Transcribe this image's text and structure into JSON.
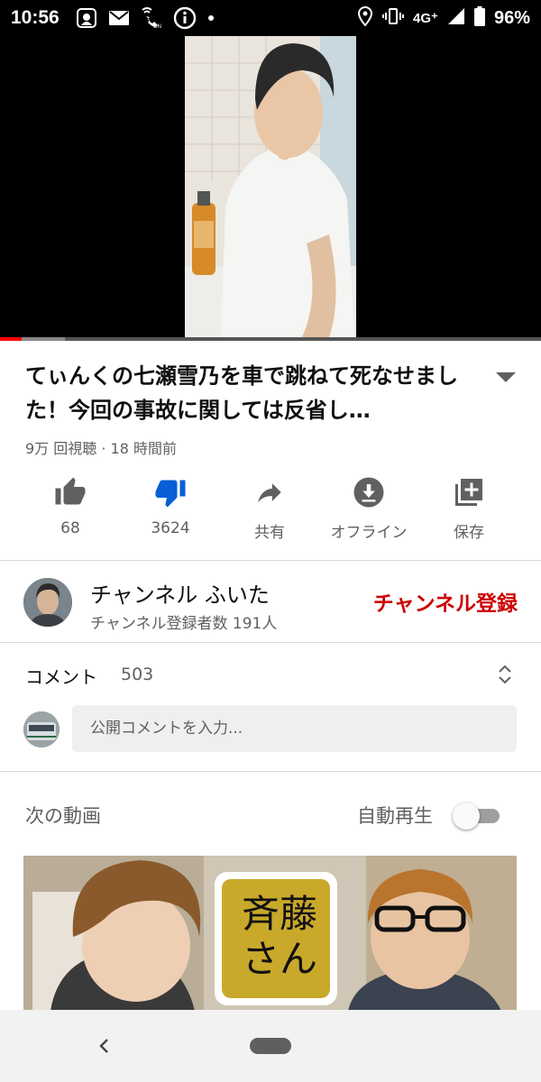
{
  "status_bar": {
    "time": "10:56",
    "network": "4G⁺",
    "battery": "96%",
    "icons": [
      "app-notification-icon",
      "mail-icon",
      "wifi-calling-icon",
      "info-icon",
      "dot-icon",
      "location-icon",
      "vibrate-icon",
      "signal-icon",
      "battery-icon"
    ]
  },
  "video": {
    "progress_played": 0.04,
    "progress_buffered": 0.12
  },
  "title": "てぃんくの七瀬雪乃を車で跳ねて死なせました！今回の事故に関しては反省し…",
  "meta": "9万 回視聴 · 18 時間前",
  "actions": [
    {
      "icon": "thumbs-up-icon",
      "label": "68"
    },
    {
      "icon": "thumbs-down-icon",
      "label": "3624"
    },
    {
      "icon": "share-icon",
      "label": "共有"
    },
    {
      "icon": "download-icon",
      "label": "オフライン"
    },
    {
      "icon": "save-playlist-icon",
      "label": "保存"
    }
  ],
  "channel": {
    "name": "チャンネル ふいた",
    "subscribers": "チャンネル登録者数 191人",
    "subscribe_label": "チャンネル登録"
  },
  "comments": {
    "title": "コメント",
    "count": "503",
    "placeholder": "公開コメントを入力..."
  },
  "up_next": {
    "title": "次の動画",
    "autoplay_label": "自動再生",
    "autoplay_on": false,
    "thumb_text": [
      "斉藤",
      "さん"
    ]
  },
  "colors": {
    "accent_red": "#cc0000",
    "dislike_blue": "#065fd4",
    "progress_red": "#ff0000"
  }
}
